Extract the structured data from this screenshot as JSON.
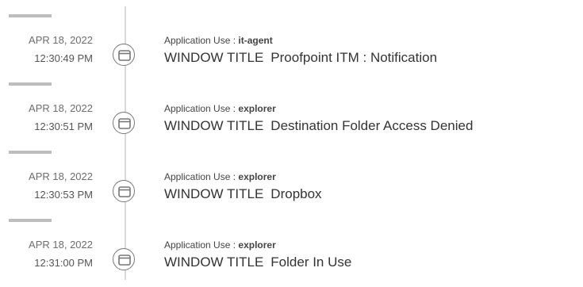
{
  "activity": {
    "entries": [
      {
        "date": "APR 18, 2022",
        "time": "12:30:49 PM",
        "app_label": "Application Use :",
        "app_name": "it-agent",
        "title_label": "WINDOW TITLE",
        "title_value": "Proofpoint ITM : Notification",
        "icon": "window-icon"
      },
      {
        "date": "APR 18, 2022",
        "time": "12:30:51 PM",
        "app_label": "Application Use :",
        "app_name": "explorer",
        "title_label": "WINDOW TITLE",
        "title_value": "Destination Folder Access Denied",
        "icon": "window-icon"
      },
      {
        "date": "APR 18, 2022",
        "time": "12:30:53 PM",
        "app_label": "Application Use :",
        "app_name": "explorer",
        "title_label": "WINDOW TITLE",
        "title_value": "Dropbox",
        "icon": "window-icon"
      },
      {
        "date": "APR 18, 2022",
        "time": "12:31:00 PM",
        "app_label": "Application Use :",
        "app_name": "explorer",
        "title_label": "WINDOW TITLE",
        "title_value": "Folder In Use",
        "icon": "window-icon"
      }
    ]
  },
  "colors": {
    "timeline_line": "#d9d9d9",
    "separator_bar": "#bdbdbd",
    "node_border": "#777777",
    "text": "#333333"
  }
}
